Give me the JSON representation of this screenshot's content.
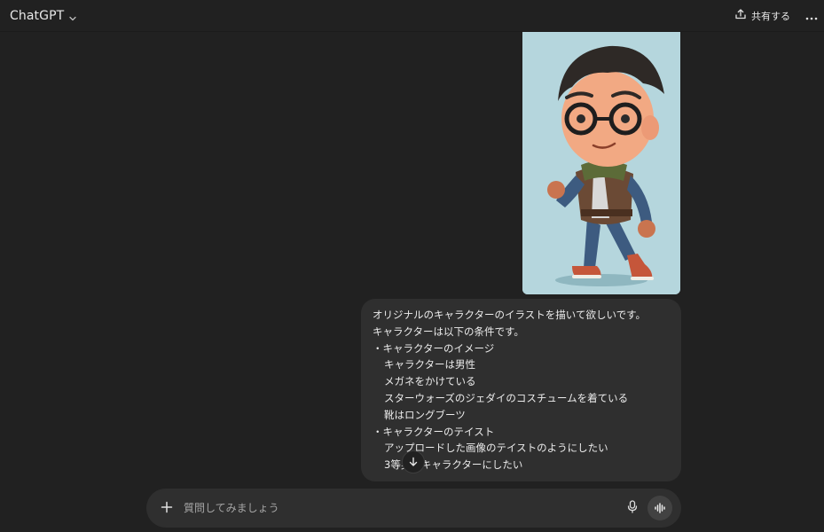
{
  "header": {
    "model_name": "ChatGPT",
    "share_label": "共有する"
  },
  "message": {
    "lines": [
      "オリジナルのキャラクターのイラストを描いて欲しいです。",
      "キャラクターは以下の条件です。",
      "・キャラクターのイメージ",
      "キャラクターは男性",
      "メガネをかけている",
      "スターウォーズのジェダイのコスチュームを着ている",
      "靴はロングブーツ",
      "・キャラクターのテイスト",
      "アップロードした画像のテイストのようにしたい",
      "3等身のキャラクターにしたい"
    ]
  },
  "composer": {
    "placeholder": "質問してみましょう"
  },
  "colors": {
    "background": "#212121",
    "bubble": "#2f2f2f",
    "composer": "#2f2f2f",
    "text": "#ececec",
    "image_bg": "#b5d6dd"
  },
  "icons": {
    "model_dropdown": "chevron-down-icon",
    "share": "share-icon",
    "more": "more-horizontal-icon",
    "scroll": "arrow-down-icon",
    "attach": "plus-icon",
    "mic": "microphone-icon",
    "voice": "voice-mode-icon"
  }
}
